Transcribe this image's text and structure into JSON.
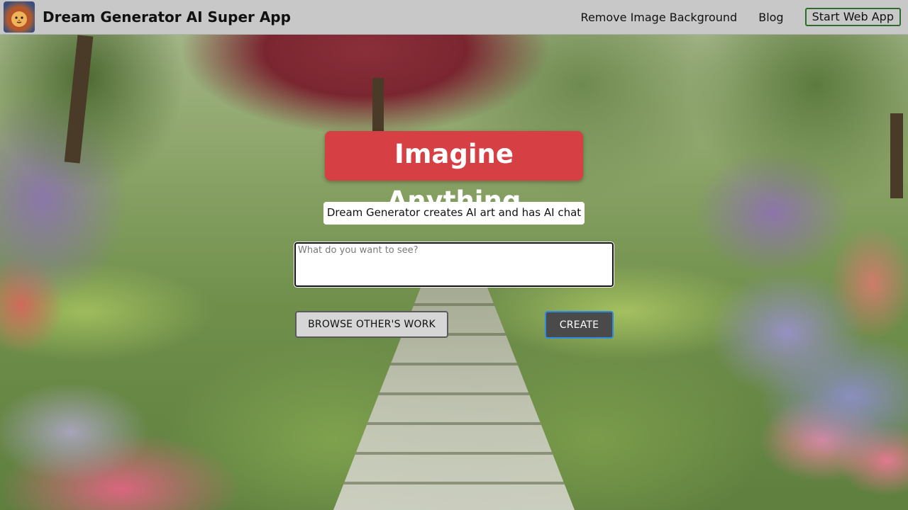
{
  "header": {
    "logo_icon": "lion-logo-icon",
    "app_title": "Dream Generator AI Super App",
    "nav": {
      "remove_bg": "Remove Image Background",
      "blog": "Blog",
      "start_web_app": "Start Web App"
    }
  },
  "hero": {
    "title": "Imagine Anything",
    "subtitle": "Dream Generator creates AI art and has AI chat",
    "prompt_placeholder": "What do you want to see?",
    "prompt_value": "",
    "browse_label": "BROWSE OTHER'S WORK",
    "create_label": "CREATE"
  },
  "colors": {
    "header_bg": "#c8c8c8",
    "title_bg": "#d64045",
    "create_bg": "#4a4a4a",
    "create_border": "#2f8be0",
    "start_app_border": "#2e6b2e"
  }
}
